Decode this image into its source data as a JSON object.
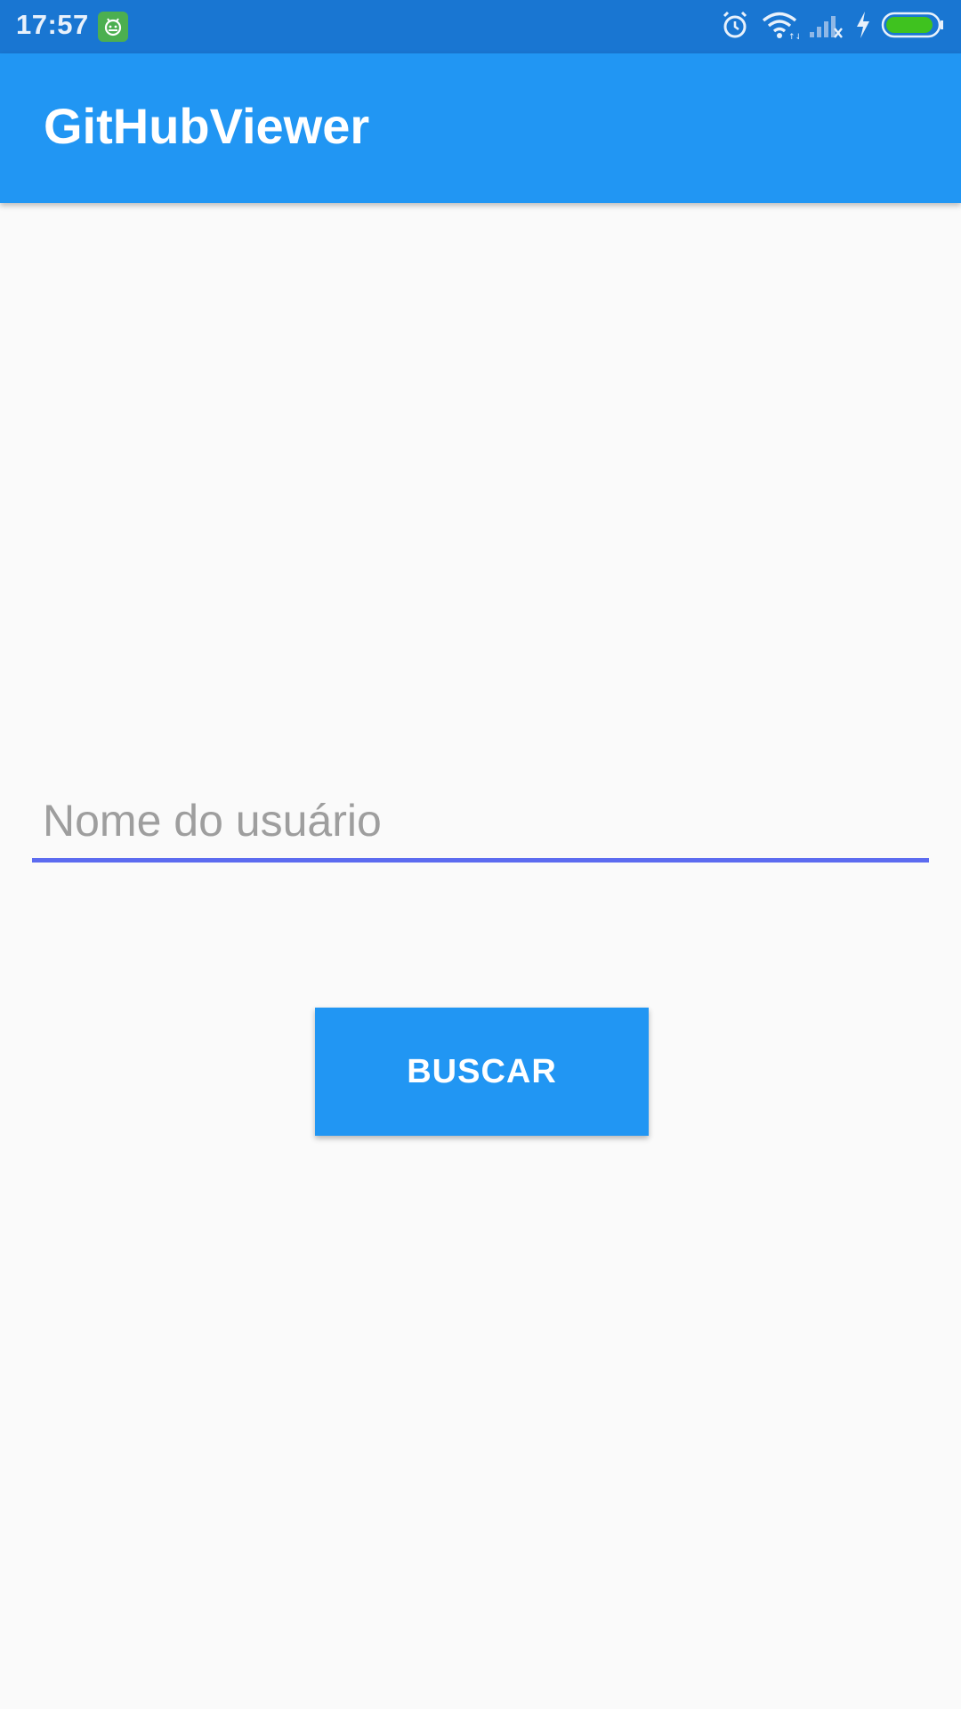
{
  "status_bar": {
    "time": "17:57",
    "icons": [
      "android-app-icon",
      "alarm-icon",
      "wifi-icon",
      "signal-icon",
      "charging-icon",
      "battery-icon"
    ],
    "battery_color": "#3fc21f"
  },
  "app_bar": {
    "title": "GitHubViewer",
    "color": "#2196f3"
  },
  "form": {
    "username_placeholder": "Nome do usuário",
    "username_value": "",
    "underline_color": "#5c6bf0",
    "search_label": "BUSCAR"
  }
}
